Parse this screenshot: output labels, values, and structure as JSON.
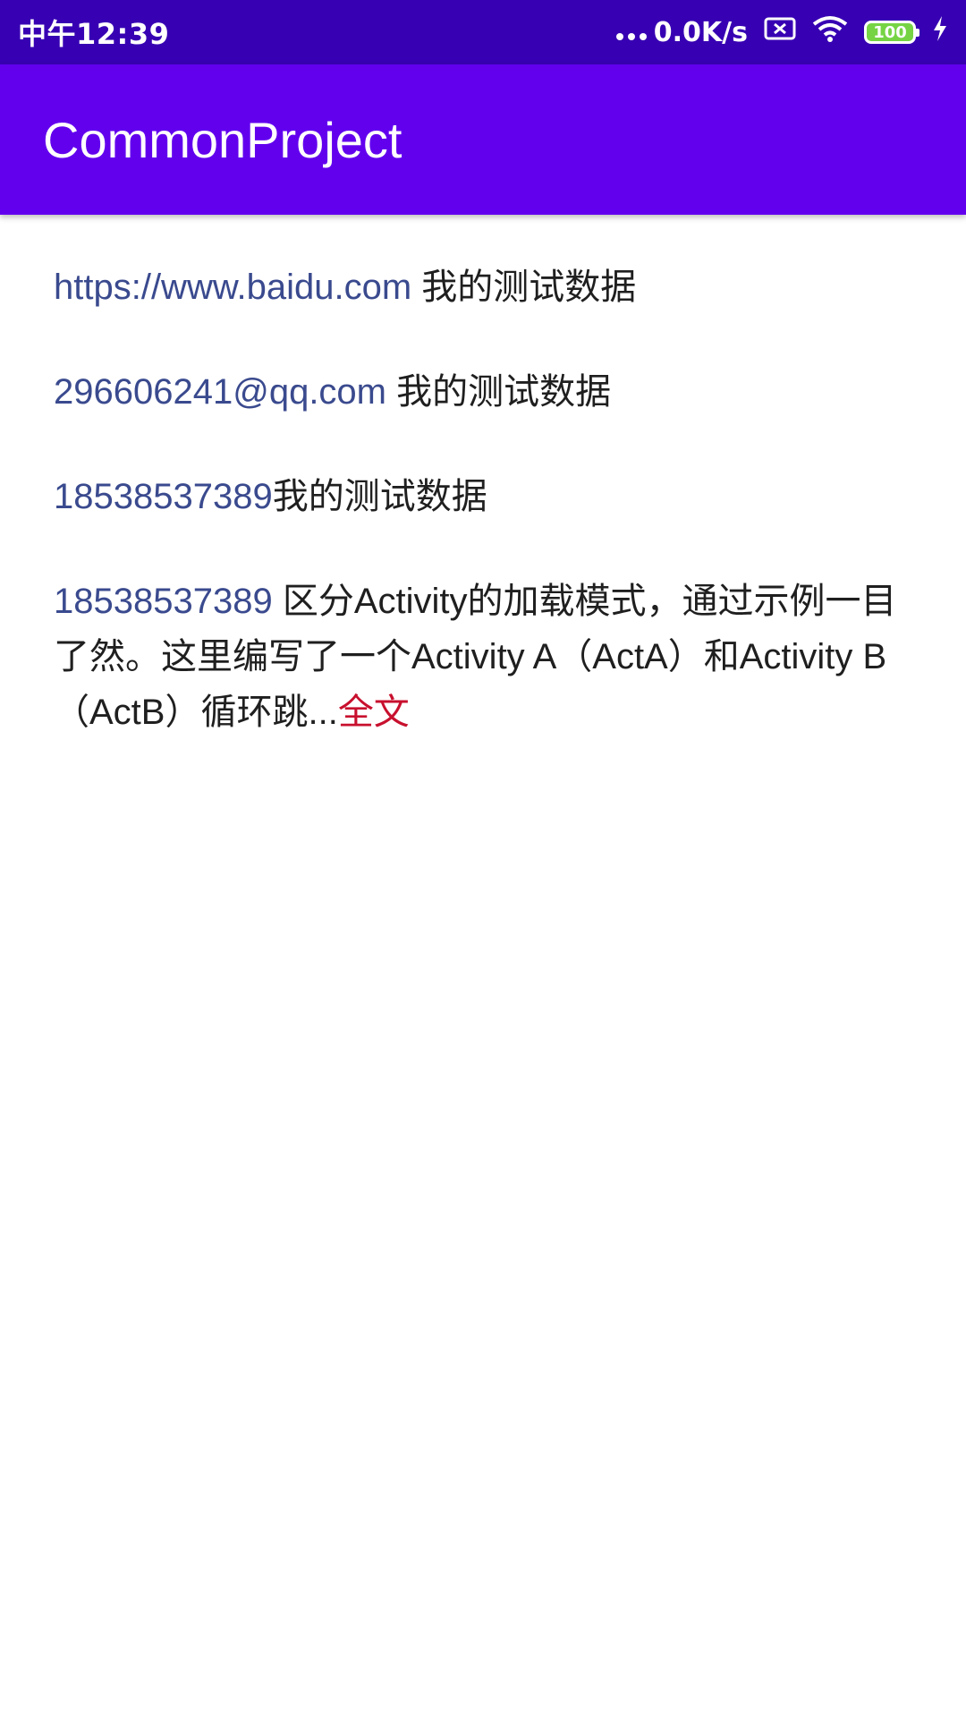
{
  "status_bar": {
    "time": "中午12:39",
    "net_speed": "0.0K/s",
    "battery": "100"
  },
  "app_bar": {
    "title": "CommonProject"
  },
  "rows": [
    {
      "link": "https://www.baidu.com",
      "text": " 我的测试数据"
    },
    {
      "link": "296606241@qq.com",
      "text": " 我的测试数据"
    },
    {
      "link": "18538537389",
      "text": "我的测试数据"
    },
    {
      "link": "18538537389",
      "text": " 区分Activity的加载模式，通过示例一目了然。这里编写了一个Activity A（ActA）和Activity B（ActB）循环跳...",
      "more": "全文"
    }
  ],
  "colors": {
    "status_bar": "#3700b3",
    "app_bar": "#6200ee",
    "link": "#3a4a8e",
    "more": "#c8102e"
  },
  "icons": [
    "signal-dots-icon",
    "sim-card-icon",
    "wifi-icon",
    "battery-icon",
    "charging-icon"
  ]
}
